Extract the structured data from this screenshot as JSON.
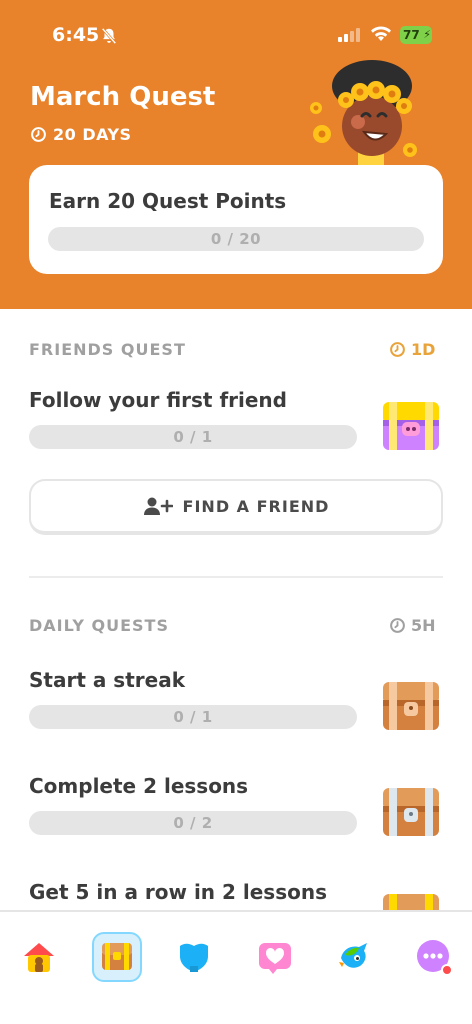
{
  "status_bar": {
    "time": "6:45",
    "battery": "77"
  },
  "header": {
    "title": "March Quest",
    "days_label": "20 DAYS",
    "card_title": "Earn 20 Quest Points",
    "progress_text": "0 / 20",
    "progress_fraction": 0
  },
  "friends_quest": {
    "section_title": "FRIENDS QUEST",
    "timer": "1D",
    "quest_label": "Follow your first friend",
    "progress_text": "0 / 1",
    "progress_fraction": 0,
    "button_label": "FIND A FRIEND"
  },
  "daily_quests": {
    "section_title": "DAILY QUESTS",
    "timer": "5H",
    "items": [
      {
        "label": "Start a streak",
        "progress_text": "0 / 1",
        "progress_fraction": 0
      },
      {
        "label": "Complete 2 lessons",
        "progress_text": "0 / 2",
        "progress_fraction": 0
      },
      {
        "label": "Get 5 in a row in 2 lessons"
      }
    ]
  },
  "nav": {
    "items": [
      "home-icon",
      "quests-chest-icon",
      "shield-league-icon",
      "heart-practice-icon",
      "bird-icon",
      "more-icon"
    ]
  },
  "colors": {
    "header_bg": "#e8822b",
    "accent_orange": "#e8a33b",
    "progress_bg": "#e5e5e5",
    "nav_active_bg": "#d7f0fb"
  }
}
